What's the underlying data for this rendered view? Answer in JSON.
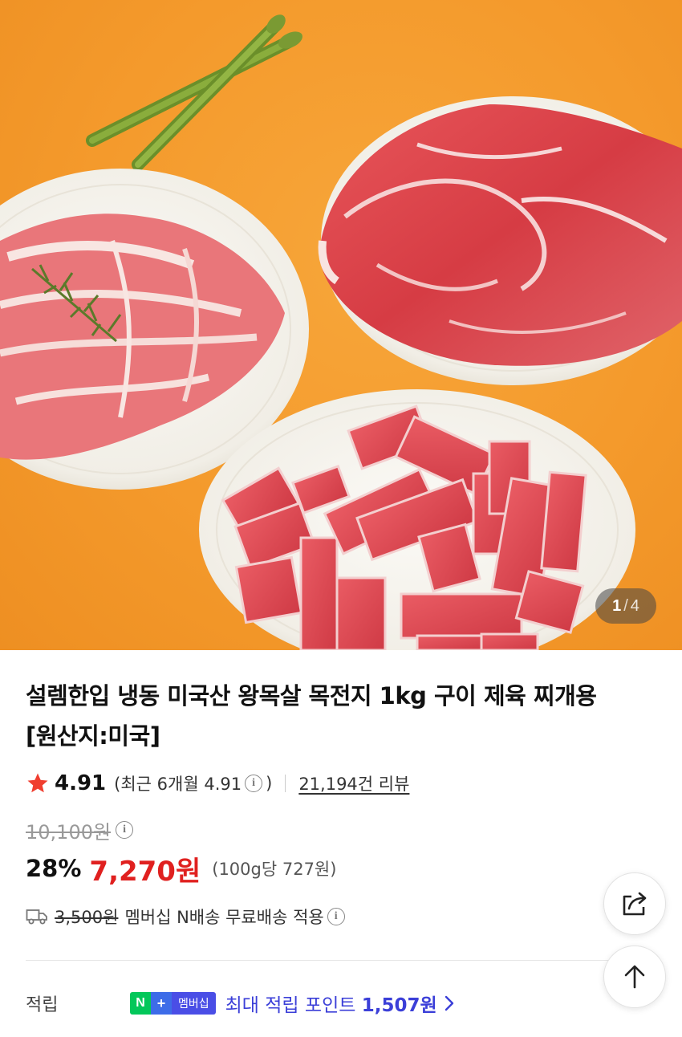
{
  "image": {
    "alt": "",
    "page_current": "1",
    "page_separator": "/",
    "page_total": "4"
  },
  "product": {
    "title_line1": "설렘한입 냉동 미국산 왕목살 목전지 1kg 구이 제육 찌개용",
    "title_line2": "[원산지:미국]"
  },
  "rating": {
    "icon": "star-icon",
    "value": "4.91",
    "recent_prefix": "(최근 6개월 4.91",
    "recent_suffix": ")",
    "review_count": "21,194건 리뷰",
    "star_color": "#f03e2f"
  },
  "price": {
    "original": "10,100원",
    "discount": "28%",
    "sale": "7,270원",
    "unit": "(100g당 727원)",
    "sale_color": "#e0201f"
  },
  "delivery": {
    "icon": "truck-icon",
    "fee": "3,500원",
    "text": "멤버십 N배송 무료배송 적용"
  },
  "points": {
    "label": "적립",
    "badge_n": "N",
    "badge_plus": "+",
    "badge_membership": "멤버십",
    "text": "최대 적립 포인트",
    "amount": "1,507원",
    "accent_color": "#3b3fd8"
  },
  "info_glyph": "i",
  "buttons": {
    "share_icon": "share-icon",
    "top_icon": "arrow-up-icon"
  }
}
